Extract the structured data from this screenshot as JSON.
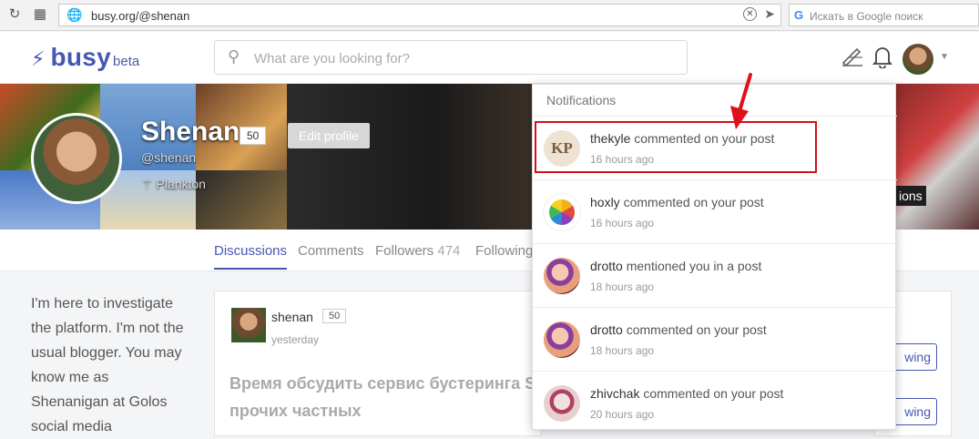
{
  "browser": {
    "url": "busy.org/@shenan",
    "search_placeholder": "Искать в Google поиск"
  },
  "header": {
    "logo": "busy",
    "logo_badge": "beta",
    "search_placeholder": "What are you looking for?"
  },
  "profile": {
    "name": "Shenan",
    "reputation": "50",
    "edit_label": "Edit profile",
    "handle": "@shenan",
    "rank": "Plankton",
    "cover_cutoff_label": "ions"
  },
  "tabs": {
    "discussions": "Discussions",
    "comments": "Comments",
    "followers": "Followers",
    "followers_count": "474",
    "following": "Following"
  },
  "bio": "I'm here to investigate the platform. I'm not the usual blogger. You may know me as Shenanigan at Golos social media",
  "post": {
    "author": "shenan",
    "reputation": "50",
    "time": "yesterday",
    "title": "Время обсудить сервис бустеринга St прочих частных"
  },
  "right_panel": {
    "follow_label_1": "wing",
    "follow_label_2": "wing"
  },
  "notifications": {
    "title": "Notifications",
    "items": [
      {
        "user": "thekyle",
        "action": "commented on your post",
        "time": "16 hours ago"
      },
      {
        "user": "hoxly",
        "action": "commented on your post",
        "time": "16 hours ago"
      },
      {
        "user": "drotto",
        "action": "mentioned you in a post",
        "time": "18 hours ago"
      },
      {
        "user": "drotto",
        "action": "commented on your post",
        "time": "18 hours ago"
      },
      {
        "user": "zhivchak",
        "action": "commented on your post",
        "time": "20 hours ago"
      }
    ]
  },
  "colors": {
    "brand": "#4757b2",
    "highlight": "#d0111b"
  }
}
